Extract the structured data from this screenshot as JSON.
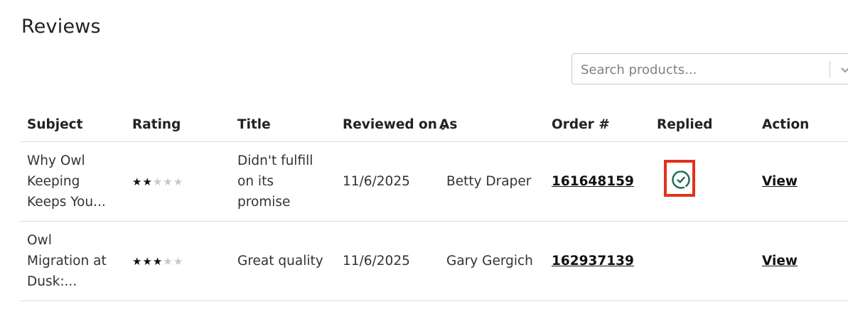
{
  "page": {
    "title": "Reviews"
  },
  "search": {
    "placeholder": "Search products..."
  },
  "table": {
    "headers": {
      "subject": "Subject",
      "rating": "Rating",
      "title": "Title",
      "reviewed_on": "Reviewed on",
      "as": "As",
      "order": "Order #",
      "replied": "Replied",
      "action": "Action"
    },
    "rows": [
      {
        "subject_lines": [
          "Why Owl",
          "Keeping",
          "Keeps You..."
        ],
        "rating": 2,
        "title_lines": [
          "Didn't fulfill",
          "on its",
          "promise"
        ],
        "reviewed_on": "11/6/2025",
        "as": "Betty Draper",
        "order": "161648159",
        "replied": true,
        "action": "View"
      },
      {
        "subject_lines": [
          "Owl",
          "Migration at",
          "Dusk:..."
        ],
        "rating": 3,
        "title_lines": [
          "Great quality"
        ],
        "reviewed_on": "11/6/2025",
        "as": "Gary Gergich",
        "order": "162937139",
        "replied": false,
        "action": "View"
      }
    ]
  },
  "icons": {
    "search_chevron": "chevron-down-icon",
    "sort": "chevron-down-icon",
    "replied": "check-circle-icon",
    "star": "star-icon"
  },
  "colors": {
    "replied_icon": "#1e6b52",
    "highlight_border": "#e2311d",
    "star_filled": "#111111",
    "star_empty": "#c8c8c8"
  }
}
